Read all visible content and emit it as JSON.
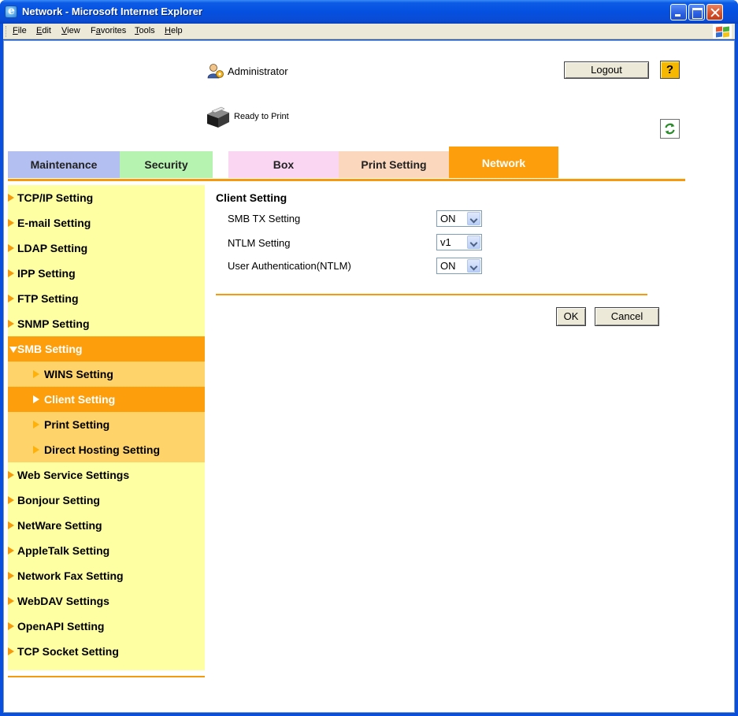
{
  "window": {
    "title": "Network - Microsoft Internet Explorer",
    "menu": [
      {
        "label": "File",
        "u": "F",
        "rest": "ile"
      },
      {
        "label": "Edit",
        "u": "E",
        "rest": "dit"
      },
      {
        "label": "View",
        "u": "V",
        "rest": "iew"
      },
      {
        "label": "Favorites",
        "pre": "F",
        "u": "a",
        "rest": "vorites"
      },
      {
        "label": "Tools",
        "u": "T",
        "rest": "ools"
      },
      {
        "label": "Help",
        "u": "H",
        "rest": "elp"
      }
    ]
  },
  "header": {
    "user": "Administrator",
    "logout_label": "Logout",
    "help_label": "?",
    "status": "Ready to Print"
  },
  "tabs": [
    {
      "label": "Maintenance"
    },
    {
      "label": "Security"
    },
    {
      "label": "Box"
    },
    {
      "label": "Print Setting"
    },
    {
      "label": "Network"
    }
  ],
  "sidebar": {
    "items": [
      {
        "label": "TCP/IP Setting"
      },
      {
        "label": "E-mail Setting"
      },
      {
        "label": "LDAP Setting"
      },
      {
        "label": "IPP Setting"
      },
      {
        "label": "FTP Setting"
      },
      {
        "label": "SNMP Setting"
      },
      {
        "label": "SMB Setting"
      },
      {
        "label": "WINS Setting"
      },
      {
        "label": "Client Setting"
      },
      {
        "label": "Print Setting"
      },
      {
        "label": "Direct Hosting Setting"
      },
      {
        "label": "Web Service Settings"
      },
      {
        "label": "Bonjour Setting"
      },
      {
        "label": "NetWare Setting"
      },
      {
        "label": "AppleTalk Setting"
      },
      {
        "label": "Network Fax Setting"
      },
      {
        "label": "WebDAV Settings"
      },
      {
        "label": "OpenAPI Setting"
      },
      {
        "label": "TCP Socket Setting"
      }
    ]
  },
  "form": {
    "title": "Client Setting",
    "fields": [
      {
        "label": "SMB TX Setting",
        "value": "ON"
      },
      {
        "label": "NTLM Setting",
        "value": "v1"
      },
      {
        "label": "User Authentication(NTLM)",
        "value": "ON"
      }
    ],
    "ok_label": "OK",
    "cancel_label": "Cancel"
  },
  "colors": {
    "accent": "#fd9f0d",
    "sidebar_bg": "#fefea2",
    "submenu_bg": "#fed36a"
  }
}
